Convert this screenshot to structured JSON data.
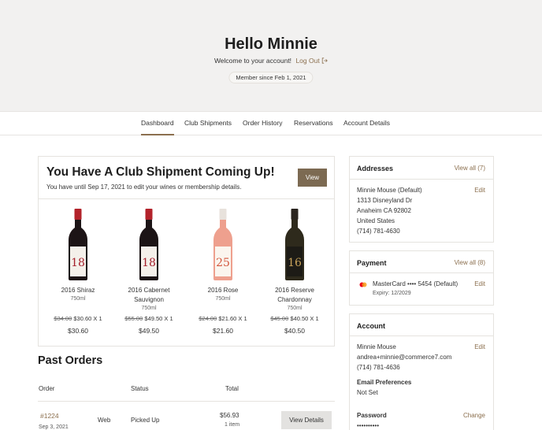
{
  "hero": {
    "greeting": "Hello Minnie",
    "welcome": "Welcome to your account!",
    "logout": "Log Out",
    "member_since": "Member since Feb 1, 2021"
  },
  "tabs": [
    "Dashboard",
    "Club Shipments",
    "Order History",
    "Reservations",
    "Account Details"
  ],
  "shipment": {
    "title": "You Have A Club Shipment Coming Up!",
    "subtitle": "You have until Sep 17, 2021 to edit your wines or membership details.",
    "view_label": "View",
    "wines": [
      {
        "name_line1": "2016 Shiraz",
        "name_line2": "",
        "volume": "750ml",
        "orig": "$34.00",
        "price": "$30.60",
        "qty": "X 1",
        "total": "$30.60",
        "label": "18",
        "bottle": "red"
      },
      {
        "name_line1": "2016 Cabernet",
        "name_line2": "Sauvignon",
        "volume": "750ml",
        "orig": "$55.00",
        "price": "$49.50",
        "qty": "X 1",
        "total": "$49.50",
        "label": "18",
        "bottle": "red"
      },
      {
        "name_line1": "2016 Rose",
        "name_line2": "",
        "volume": "750ml",
        "orig": "$24.00",
        "price": "$21.60",
        "qty": "X 1",
        "total": "$21.60",
        "label": "25",
        "bottle": "rose"
      },
      {
        "name_line1": "2016 Reserve",
        "name_line2": "Chardonnay",
        "volume": "750ml",
        "orig": "$45.00",
        "price": "$40.50",
        "qty": "X 1",
        "total": "$40.50",
        "label": "16",
        "bottle": "white"
      }
    ]
  },
  "past_orders": {
    "title": "Past Orders",
    "headers": {
      "order": "Order",
      "status": "Status",
      "total": "Total"
    },
    "rows": [
      {
        "number": "#1224",
        "date": "Sep 3, 2021",
        "channel": "Web",
        "status": "Picked Up",
        "total": "$56.93",
        "items": "1 item",
        "action": "View Details"
      }
    ]
  },
  "addresses": {
    "title": "Addresses",
    "view_all": "View all (7)",
    "edit": "Edit",
    "lines": [
      "Minnie Mouse (Default)",
      "1313 Disneyland Dr",
      "Anaheim CA 92802",
      "United States",
      "(714) 781-4630"
    ]
  },
  "payment": {
    "title": "Payment",
    "view_all": "View all (8)",
    "edit": "Edit",
    "card": "MasterCard •••• 5454 (Default)",
    "expiry": "Expiry: 12/2029"
  },
  "account": {
    "title": "Account",
    "edit": "Edit",
    "name": "Minnie Mouse",
    "email": "andrea+minnie@commerce7.com",
    "phone": "(714) 781-4636",
    "email_pref_label": "Email Preferences",
    "email_pref_value": "Not Set",
    "password_label": "Password",
    "password_value": "••••••••••",
    "change": "Change"
  },
  "colors": {
    "accent": "#8b6f4e",
    "button": "#7c6a52",
    "hero_bg": "#f2f1f0"
  }
}
